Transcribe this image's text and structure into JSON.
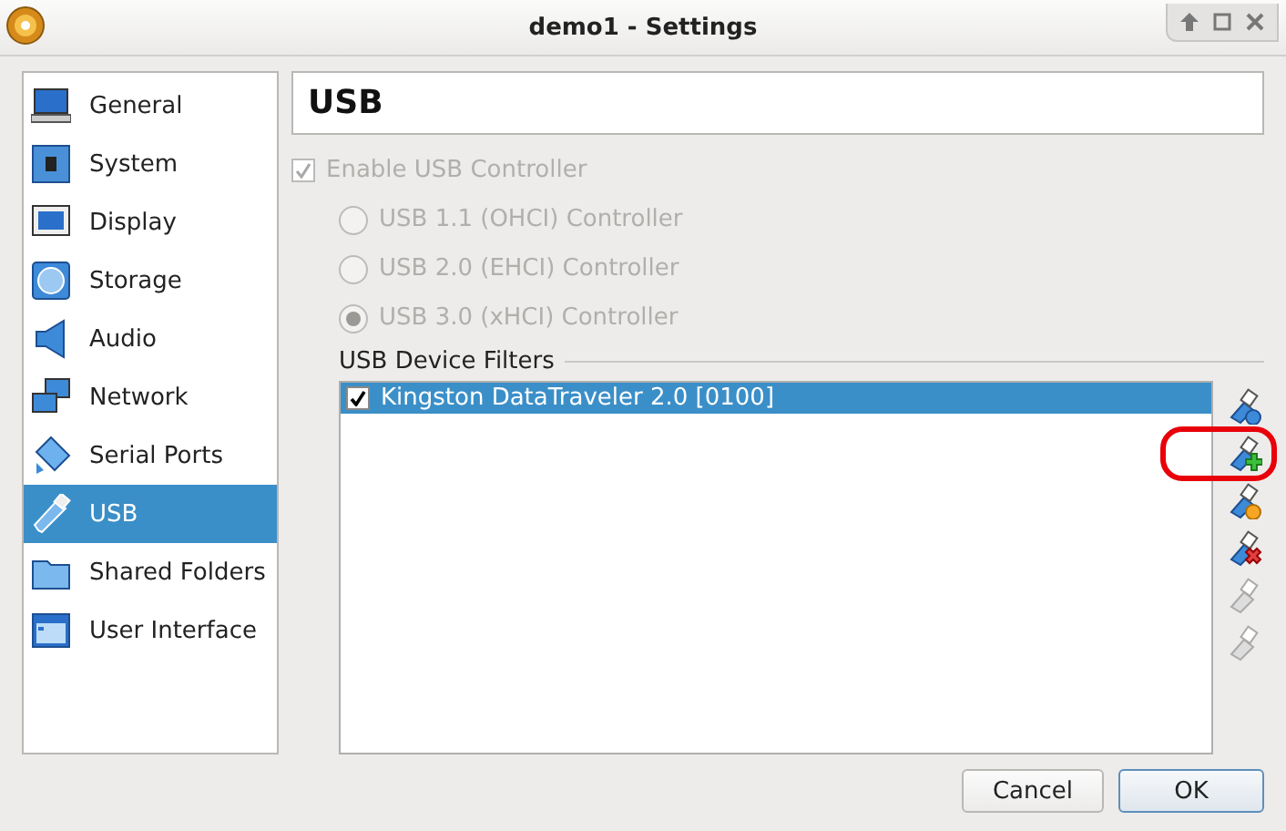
{
  "window": {
    "title": "demo1 - Settings"
  },
  "sidebar": {
    "items": [
      {
        "label": "General",
        "selected": false
      },
      {
        "label": "System",
        "selected": false
      },
      {
        "label": "Display",
        "selected": false
      },
      {
        "label": "Storage",
        "selected": false
      },
      {
        "label": "Audio",
        "selected": false
      },
      {
        "label": "Network",
        "selected": false
      },
      {
        "label": "Serial Ports",
        "selected": false
      },
      {
        "label": "USB",
        "selected": true
      },
      {
        "label": "Shared Folders",
        "selected": false
      },
      {
        "label": "User Interface",
        "selected": false
      }
    ]
  },
  "page": {
    "title": "USB",
    "enable_controller": {
      "label": "Enable USB Controller",
      "checked": true,
      "disabled": true
    },
    "controllers": [
      {
        "label": "USB 1.1 (OHCI) Controller",
        "selected": false,
        "disabled": true
      },
      {
        "label": "USB 2.0 (EHCI) Controller",
        "selected": false,
        "disabled": true
      },
      {
        "label": "USB 3.0 (xHCI) Controller",
        "selected": true,
        "disabled": true
      }
    ],
    "filters_label": "USB Device Filters",
    "filters": [
      {
        "label": "Kingston DataTraveler 2.0 [0100]",
        "checked": true,
        "selected": true
      }
    ],
    "tools": [
      {
        "kind": "new",
        "disabled": false,
        "highlighted": false
      },
      {
        "kind": "add",
        "disabled": false,
        "highlighted": true
      },
      {
        "kind": "edit",
        "disabled": false,
        "highlighted": false
      },
      {
        "kind": "remove",
        "disabled": false,
        "highlighted": false
      },
      {
        "kind": "up",
        "disabled": true,
        "highlighted": false
      },
      {
        "kind": "down",
        "disabled": true,
        "highlighted": false
      }
    ]
  },
  "buttons": [
    {
      "label": "Cancel",
      "default": false
    },
    {
      "label": "OK",
      "default": true
    }
  ]
}
